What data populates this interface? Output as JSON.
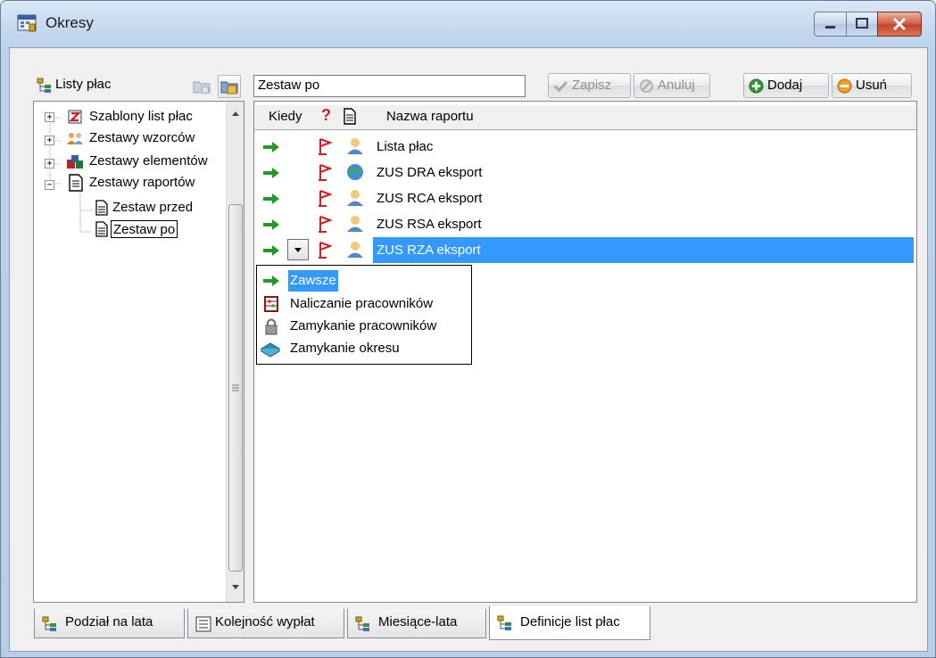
{
  "window": {
    "title": "Okresy"
  },
  "left_panel": {
    "title": "Listy płac",
    "tree": [
      {
        "label": "Szablony list płac",
        "expander": "+"
      },
      {
        "label": "Zestawy wzorców",
        "expander": "+"
      },
      {
        "label": "Zestawy elementów",
        "expander": "+"
      },
      {
        "label": "Zestawy raportów",
        "expander": "−"
      },
      {
        "label": "Zestaw przed"
      },
      {
        "label": "Zestaw po"
      }
    ]
  },
  "right_panel": {
    "name_value": "Zestaw po",
    "buttons": {
      "save": "Zapisz",
      "cancel": "Anuluj",
      "add": "Dodaj",
      "remove": "Usuń"
    },
    "grid": {
      "headers": {
        "when": "Kiedy",
        "question": "?",
        "report_name": "Nazwa raportu"
      },
      "rows": [
        {
          "name": "Lista płac",
          "icon": "person-icon"
        },
        {
          "name": "ZUS DRA eksport",
          "icon": "globe-icon"
        },
        {
          "name": "ZUS RCA eksport",
          "icon": "person-icon"
        },
        {
          "name": "ZUS RSA eksport",
          "icon": "person-icon"
        },
        {
          "name": "ZUS RZA eksport",
          "icon": "person-icon"
        }
      ],
      "selected_row": 4
    },
    "dropdown": {
      "options": [
        {
          "label": "Zawsze",
          "icon": "green-arrow-icon"
        },
        {
          "label": "Naliczanie pracowników",
          "icon": "abacus-icon"
        },
        {
          "label": "Zamykanie pracowników",
          "icon": "lock-icon"
        },
        {
          "label": "Zamykanie okresu",
          "icon": "book-icon"
        }
      ],
      "selected": 0
    }
  },
  "tabs": [
    {
      "label": "Podział na lata"
    },
    {
      "label": "Kolejność wypłat"
    },
    {
      "label": "Miesiące-lata"
    },
    {
      "label": "Definicje list płac"
    }
  ],
  "colors": {
    "selection": "#3399ff",
    "accent_green": "#1f9b1f",
    "flag_red": "#d41d1d"
  }
}
